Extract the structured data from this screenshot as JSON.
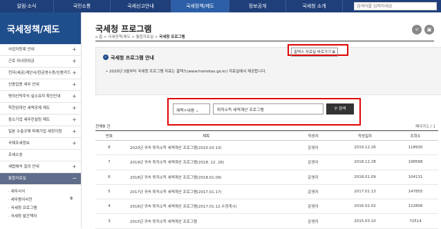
{
  "topnav": {
    "items": [
      "알림·소식",
      "국민소통",
      "국세신고안내",
      "국세정책/제도",
      "정보공개",
      "국세청 소개"
    ],
    "active_index": 3,
    "search_placeholder": "검색어를 입력하세요"
  },
  "sidebar": {
    "title": "국세정책/제도",
    "items": [
      "사업자등록 안내",
      "근로·자녀장려금",
      "전자(세금)계산서/현금영수증/신용카드",
      "신종업종 세무 안내",
      "명의신탁주식 실소유자 확인안내",
      "착한임대인 세액공제 제도",
      "중소기업 세무컨설팅 제도",
      "일본 수출규제 피해기업 세정지원",
      "국제조세정보",
      "조세소송",
      "세법해석 질의 안내",
      "통합자료실"
    ],
    "subitems": [
      "세무서식",
      "세무용어사전",
      "국세청 프로그램",
      "국세청 발간책자"
    ]
  },
  "header": {
    "title": "국세청 프로그램",
    "breadcrumb": [
      "홈",
      "국세정책/제도",
      "통합자료실",
      "국세청 프로그램"
    ]
  },
  "notice": {
    "title": "국세청 프로그램 안내",
    "text": "2020년 3월부터 국세청 프로그램 자료는 홈택스(www.hometax.go.kr) 자료실에서 제공합니다.",
    "button_label": "홈택스 자료실 바로가기"
  },
  "search": {
    "select_value": "제목+내용",
    "keyword": "퇴직소득 세액계산 프로그램",
    "button_label": "검색"
  },
  "list": {
    "total": "전체8 건",
    "page_info": "페이지1 / 1",
    "headers": [
      "번호",
      "제목",
      "작성자",
      "작성일자",
      "조회수"
    ],
    "rows": [
      [
        "8",
        "2020년 귀속 퇴직소득 세액계산 프로그램(2020.03.13)",
        "운영자",
        "2019.12.26",
        "118930"
      ],
      [
        "7",
        "2019년 귀속 퇴직소득 세액계산 프로그램(2018. 12. 28)",
        "운영자",
        "2018.12.28",
        "198568"
      ],
      [
        "6",
        "2018년 귀속 퇴직소득 세액계산 프로그램(2018.01.09)",
        "운영자",
        "2018.01.09",
        "104131"
      ],
      [
        "5",
        "2017년 귀속 퇴직소득 세액계산 프로그램(2017.01.17)",
        "운영자",
        "2017.01.13",
        "147855"
      ],
      [
        "4",
        "2016년 귀속 퇴직소득 세액계산 프로그램(2017.01.12.수정게시)",
        "운영자",
        "2016.02.02",
        "122806"
      ],
      [
        "3",
        "2015년 귀속 퇴직소득 세액계산 프로그램",
        "운영자",
        "2015.03.10",
        "72514"
      ]
    ]
  },
  "colors": {
    "nav_bg": "#1f3f7a",
    "sidebar_title_bg": "#1f4e8c",
    "highlight_red": "#e00000"
  }
}
